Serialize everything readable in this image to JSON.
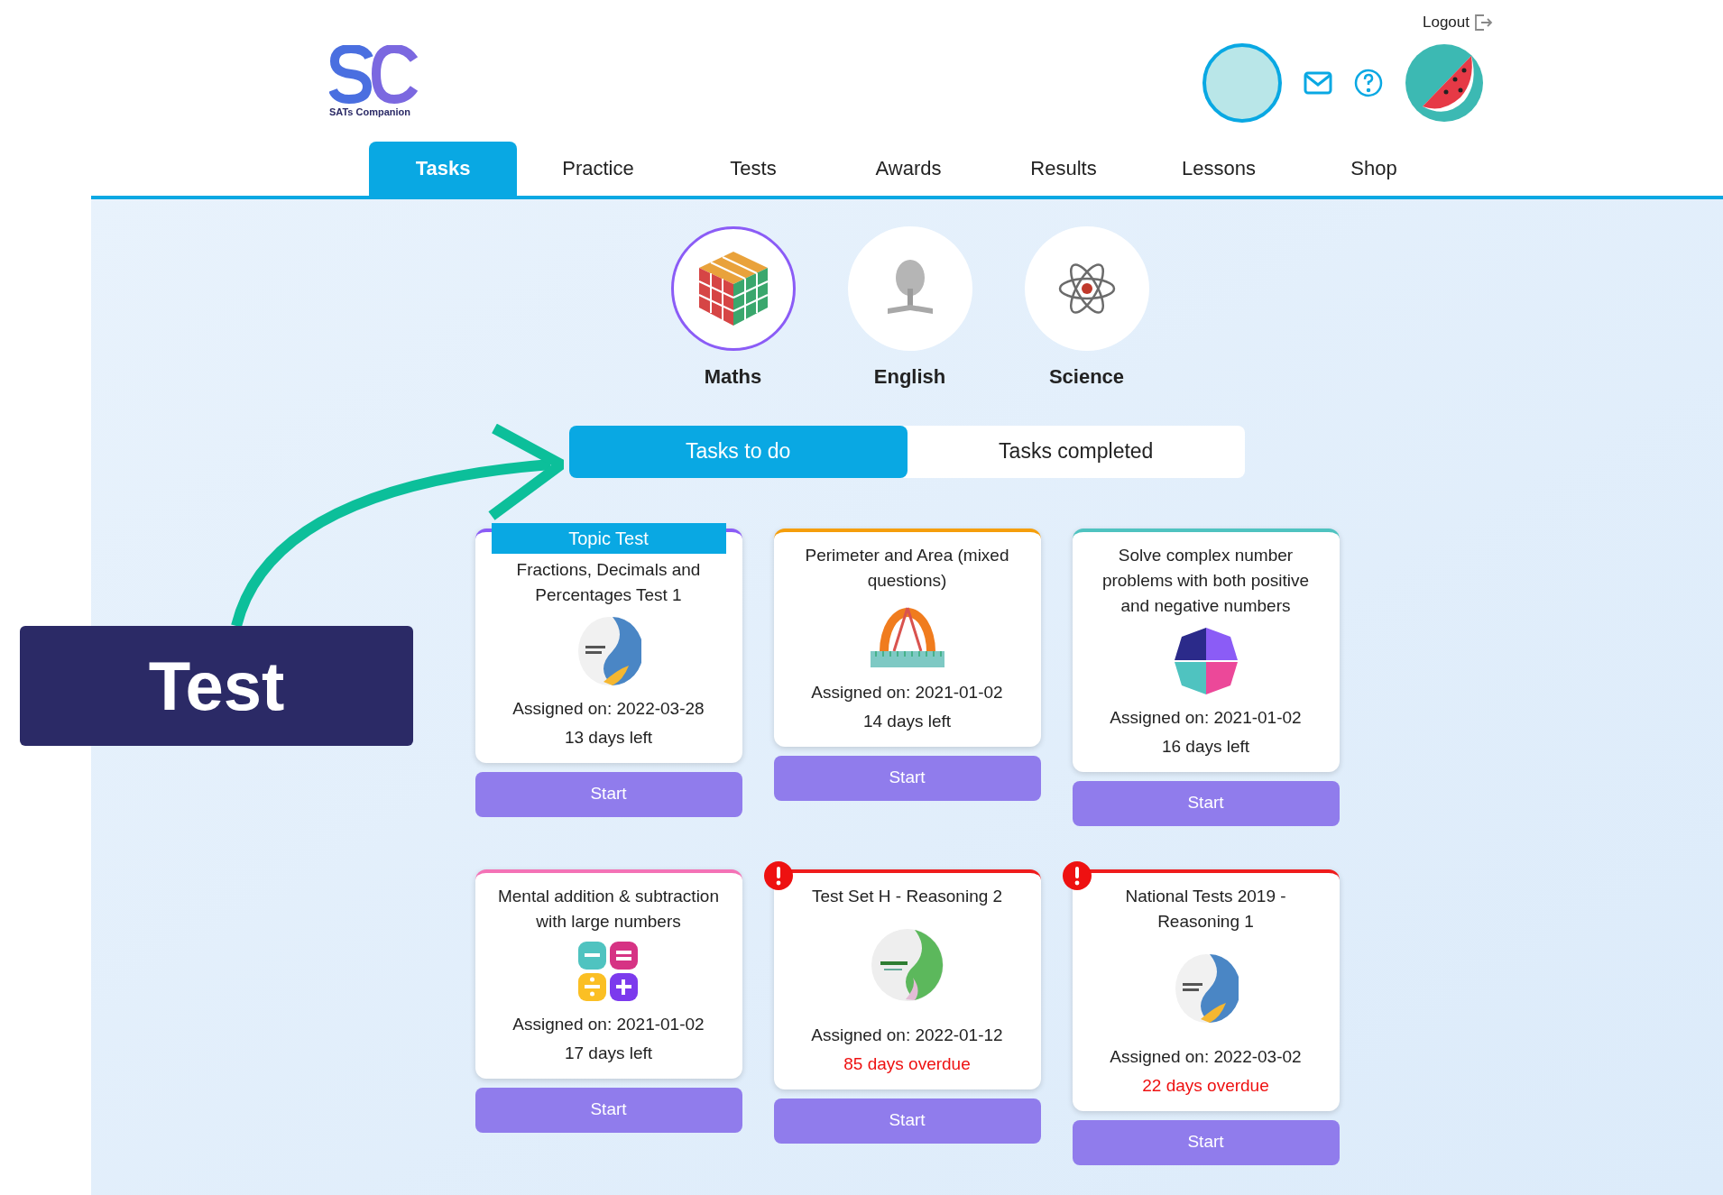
{
  "header": {
    "logout": "Logout",
    "logo_caption": "SATs Companion"
  },
  "nav_tabs": [
    {
      "label": "Tasks",
      "selected": true
    },
    {
      "label": "Practice",
      "selected": false
    },
    {
      "label": "Tests",
      "selected": false
    },
    {
      "label": "Awards",
      "selected": false
    },
    {
      "label": "Results",
      "selected": false
    },
    {
      "label": "Lessons",
      "selected": false
    },
    {
      "label": "Shop",
      "selected": false
    }
  ],
  "subjects": [
    {
      "name": "Maths",
      "kind": "cube",
      "selected": true
    },
    {
      "name": "English",
      "kind": "tree",
      "selected": false
    },
    {
      "name": "Science",
      "kind": "atom",
      "selected": false
    }
  ],
  "task_toggle": [
    {
      "label": "Tasks to do",
      "selected": true
    },
    {
      "label": "Tasks completed",
      "selected": false
    }
  ],
  "tasks": [
    {
      "badge": "Topic Test",
      "title": "Fractions, Decimals and Percentages Test 1",
      "kind": "cover-blue",
      "color": "#8b5cf6",
      "assigned": "Assigned on: 2022-03-28",
      "due": "13 days left",
      "overdue": false,
      "button": "Start"
    },
    {
      "title": "Perimeter and Area (mixed questions)",
      "kind": "protractor",
      "color": "#f59e0b",
      "assigned": "Assigned on: 2021-01-02",
      "due": "14 days left",
      "overdue": false,
      "button": "Start"
    },
    {
      "title": "Solve complex number problems with both positive and negative numbers",
      "kind": "quadrants",
      "color": "#4fc3c0",
      "assigned": "Assigned on: 2021-01-02",
      "due": "16 days left",
      "overdue": false,
      "button": "Start"
    },
    {
      "title": "Mental addition & subtraction with large numbers",
      "kind": "operators",
      "color": "#f472b6",
      "assigned": "Assigned on: 2021-01-02",
      "due": "17 days left",
      "overdue": false,
      "button": "Start"
    },
    {
      "title": "Test Set H - Reasoning 2",
      "kind": "cover-green",
      "color": "#ef1c1c",
      "assigned": "Assigned on: 2022-01-12",
      "due": "85 days overdue",
      "overdue": true,
      "button": "Start"
    },
    {
      "title": "National Tests 2019 - Reasoning 1",
      "kind": "cover-blue",
      "color": "#ef1c1c",
      "assigned": "Assigned on: 2022-03-02",
      "due": "22 days overdue",
      "overdue": true,
      "button": "Start"
    }
  ],
  "annotation": {
    "label": "Test"
  }
}
